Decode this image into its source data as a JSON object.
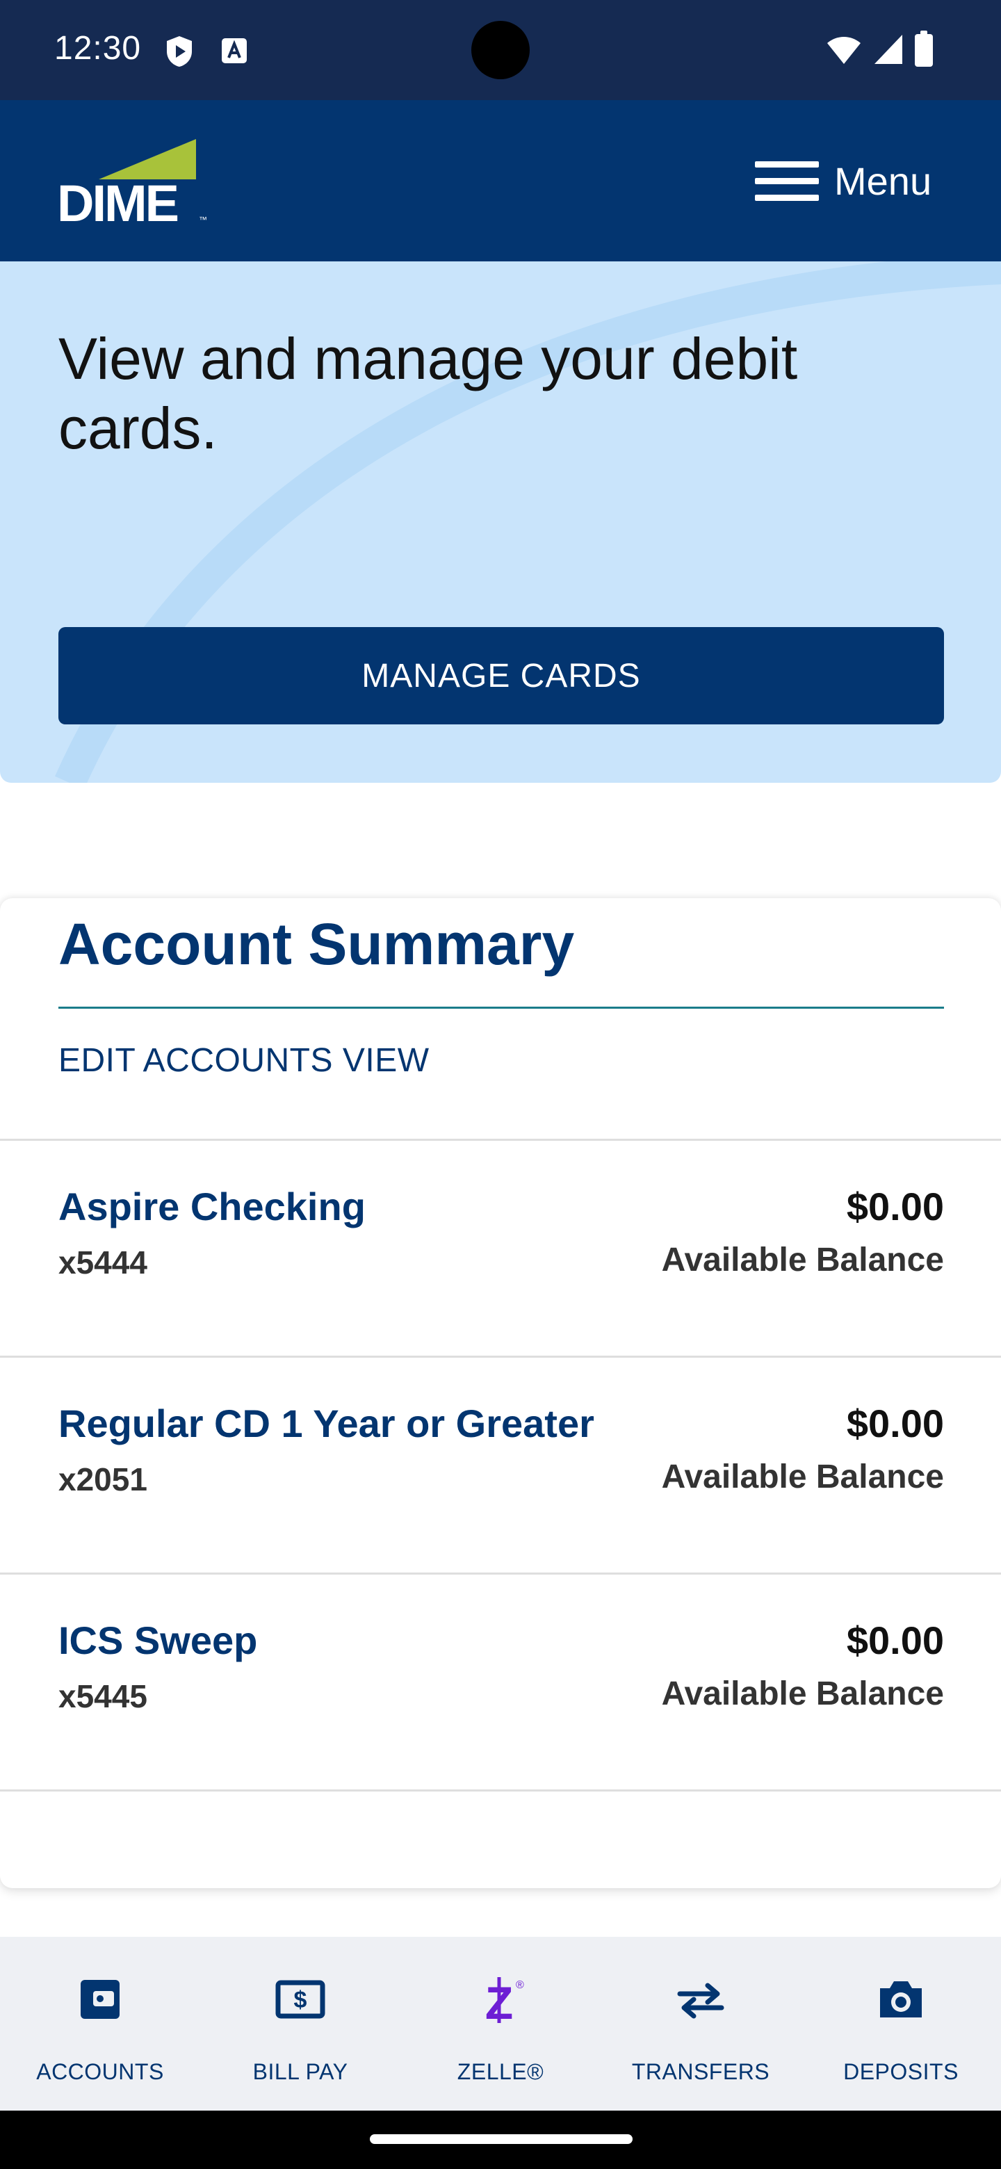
{
  "status_bar": {
    "time": "12:30",
    "icons": [
      "shield-icon",
      "font-a-icon",
      "wifi-icon",
      "signal-icon",
      "battery-icon"
    ]
  },
  "header": {
    "logo_text": "DIME",
    "menu_label": "Menu"
  },
  "promo": {
    "title": "View and manage your debit cards.",
    "button_label": "MANAGE CARDS"
  },
  "summary": {
    "title": "Account Summary",
    "edit_label": "EDIT ACCOUNTS VIEW",
    "accounts": [
      {
        "name": "Aspire Checking",
        "number": "x5444",
        "balance": "$0.00",
        "balance_label": "Available Balance"
      },
      {
        "name": "Regular CD 1 Year or Greater",
        "number": "x2051",
        "balance": "$0.00",
        "balance_label": "Available Balance"
      },
      {
        "name": "ICS Sweep",
        "number": "x5445",
        "balance": "$0.00",
        "balance_label": "Available Balance"
      }
    ]
  },
  "bottom_nav": {
    "items": [
      {
        "label": "ACCOUNTS",
        "icon": "wallet-icon"
      },
      {
        "label": "BILL PAY",
        "icon": "bill-icon"
      },
      {
        "label": "ZELLE®",
        "icon": "zelle-icon"
      },
      {
        "label": "TRANSFERS",
        "icon": "transfer-arrows-icon"
      },
      {
        "label": "DEPOSITS",
        "icon": "camera-icon"
      }
    ]
  },
  "colors": {
    "brand_navy": "#033570",
    "status_bar": "#152a52",
    "promo_bg": "#c9e4fb",
    "logo_green": "#a8c23a",
    "zelle_purple": "#6d1ed4"
  }
}
